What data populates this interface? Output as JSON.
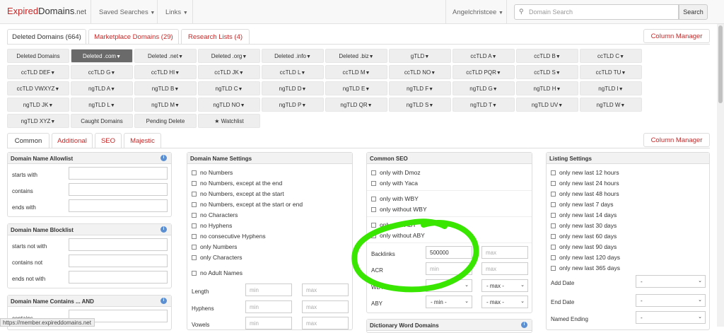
{
  "nav": {
    "logo_main": "Expired",
    "logo_rest": "Domains",
    "logo_net": ".net",
    "saved_searches": "Saved Searches",
    "links": "Links",
    "user": "Angelchristcee",
    "search_placeholder": "Domain Search",
    "search_button": "Search"
  },
  "top_tabs": [
    "Deleted Domains (664)",
    "Marketplace Domains (29)",
    "Research Lists (4)"
  ],
  "column_manager": "Column Manager",
  "tld_grid": [
    [
      "Deleted Domains",
      "Deleted .com",
      "Deleted .net",
      "Deleted .org",
      "Deleted .info",
      "Deleted .biz",
      "gTLD",
      "ccTLD A",
      "ccTLD B",
      "ccTLD C"
    ],
    [
      "ccTLD DEF",
      "ccTLD G",
      "ccTLD HI",
      "ccTLD JK",
      "ccTLD L",
      "ccTLD M",
      "ccTLD NO",
      "ccTLD PQR",
      "ccTLD S",
      "ccTLD TU"
    ],
    [
      "ccTLD VWXYZ",
      "ngTLD A",
      "ngTLD B",
      "ngTLD C",
      "ngTLD D",
      "ngTLD E",
      "ngTLD F",
      "ngTLD G",
      "ngTLD H",
      "ngTLD I"
    ],
    [
      "ngTLD JK",
      "ngTLD L",
      "ngTLD M",
      "ngTLD NO",
      "ngTLD P",
      "ngTLD QR",
      "ngTLD S",
      "ngTLD T",
      "ngTLD UV",
      "ngTLD W"
    ],
    [
      "ngTLD XYZ",
      "Caught Domains",
      "Pending Delete",
      "★ Watchlist"
    ]
  ],
  "tld_no_caret": [
    "Deleted Domains",
    "Caught Domains",
    "Pending Delete",
    "★ Watchlist"
  ],
  "selected_tld": "Deleted .com",
  "filter_tabs": [
    "Common",
    "Additional",
    "SEO",
    "Majestic"
  ],
  "allowlist": {
    "title": "Domain Name Allowlist",
    "rows": [
      "starts with",
      "contains",
      "ends with"
    ]
  },
  "blocklist": {
    "title": "Domain Name Blocklist",
    "rows": [
      "starts not with",
      "contains not",
      "ends not with"
    ]
  },
  "contains_and": {
    "title": "Domain Name Contains ... AND",
    "rows": [
      "contains"
    ]
  },
  "name_settings": {
    "title": "Domain Name Settings",
    "checks": [
      "no Numbers",
      "no Numbers, except at the end",
      "no Numbers, except at the start",
      "no Numbers, except at the start or end",
      "no Characters",
      "no Hyphens",
      "no consecutive Hyphens",
      "only Numbers",
      "only Characters"
    ],
    "adult": "no Adult Names",
    "ranges": [
      "Length",
      "Hyphens",
      "Vowels"
    ],
    "min": "min",
    "max": "max"
  },
  "common_seo": {
    "title": "Common SEO",
    "group1": [
      "only with Dmoz",
      "only with Yaca"
    ],
    "group2": [
      "only with WBY",
      "only without WBY"
    ],
    "group3": [
      "only with ABY",
      "only without ABY"
    ],
    "backlinks_label": "Backlinks",
    "backlinks_value": "500000",
    "acr_label": "ACR",
    "wby_label": "WBY",
    "aby_label": "ABY",
    "min_select": "- min -",
    "max_select": "- max -"
  },
  "dictionary": {
    "title": "Dictionary Word Domains"
  },
  "listing": {
    "title": "Listing Settings",
    "checks": [
      "only new last 12 hours",
      "only new last 24 hours",
      "only new last 48 hours",
      "only new last 7 days",
      "only new last 14 days",
      "only new last 30 days",
      "only new last 60 days",
      "only new last 90 days",
      "only new last 120 days",
      "only new last 365 days"
    ],
    "add_date": "Add Date",
    "end_date": "End Date",
    "named_ending": "Named Ending",
    "dash": "-"
  },
  "status_url": "https://member.expireddomains.net",
  "colors": {
    "accent": "#c62828",
    "annotation": "#39e600",
    "selected": "#6a6a6a"
  }
}
